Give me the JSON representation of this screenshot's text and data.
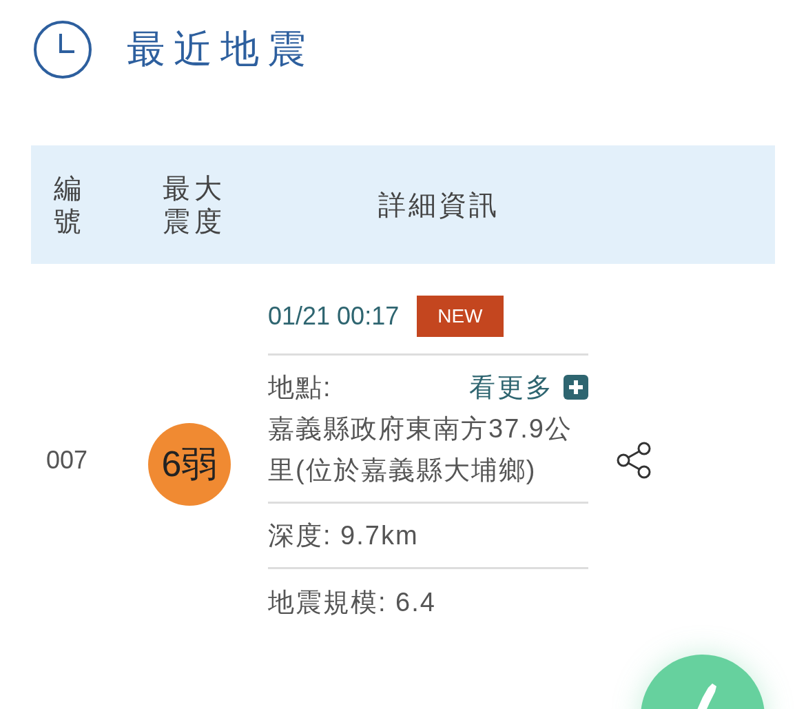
{
  "header": {
    "title": "最近地震"
  },
  "table": {
    "columns": [
      {
        "label": "編號"
      },
      {
        "label": "最大震度"
      },
      {
        "label": "詳細資訊"
      }
    ],
    "rows": [
      {
        "number": "007",
        "intensity": "6弱",
        "time": "01/21 00:17",
        "new_badge": "NEW",
        "location_label": "地點:",
        "more_link": "看更多",
        "location": "嘉義縣政府東南方37.9公里(位於嘉義縣大埔鄉)",
        "depth": "深度: 9.7km",
        "magnitude": "地震規模: 6.4"
      }
    ]
  }
}
